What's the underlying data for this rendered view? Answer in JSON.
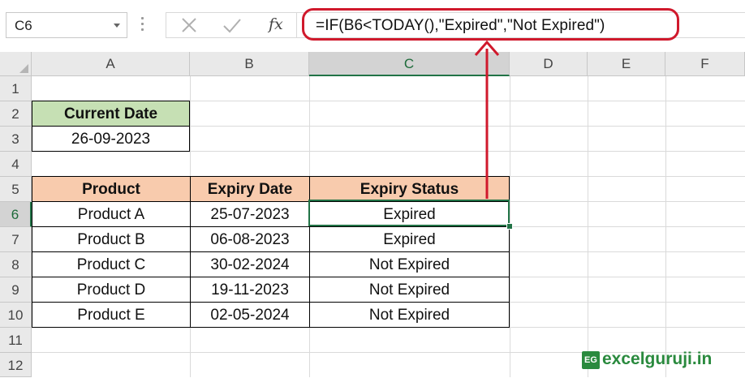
{
  "name_box": {
    "value": "C6"
  },
  "formula_bar": {
    "fx_label": "fx",
    "formula": "=IF(B6<TODAY(),\"Expired\",\"Not Expired\")"
  },
  "columns": [
    "A",
    "B",
    "C",
    "D",
    "E",
    "F"
  ],
  "rows": [
    "1",
    "2",
    "3",
    "4",
    "5",
    "6",
    "7",
    "8",
    "9",
    "10",
    "11",
    "12"
  ],
  "cells": {
    "current_date_label": "Current Date",
    "current_date_value": "26-09-2023",
    "headers": {
      "product": "Product",
      "expiry_date": "Expiry Date",
      "expiry_status": "Expiry Status"
    },
    "table": [
      {
        "product": "Product A",
        "expiry_date": "25-07-2023",
        "status": "Expired"
      },
      {
        "product": "Product B",
        "expiry_date": "06-08-2023",
        "status": "Expired"
      },
      {
        "product": "Product C",
        "expiry_date": "30-02-2024",
        "status": "Not Expired"
      },
      {
        "product": "Product D",
        "expiry_date": "19-11-2023",
        "status": "Not Expired"
      },
      {
        "product": "Product E",
        "expiry_date": "02-05-2024",
        "status": "Not Expired"
      }
    ]
  },
  "watermark": {
    "logo": "EG",
    "text": "excelguruji.in"
  },
  "colors": {
    "accent_green": "#217346",
    "highlight_red": "#d0192c",
    "green_fill": "#c6e0b4",
    "peach_fill": "#f8cbad"
  }
}
